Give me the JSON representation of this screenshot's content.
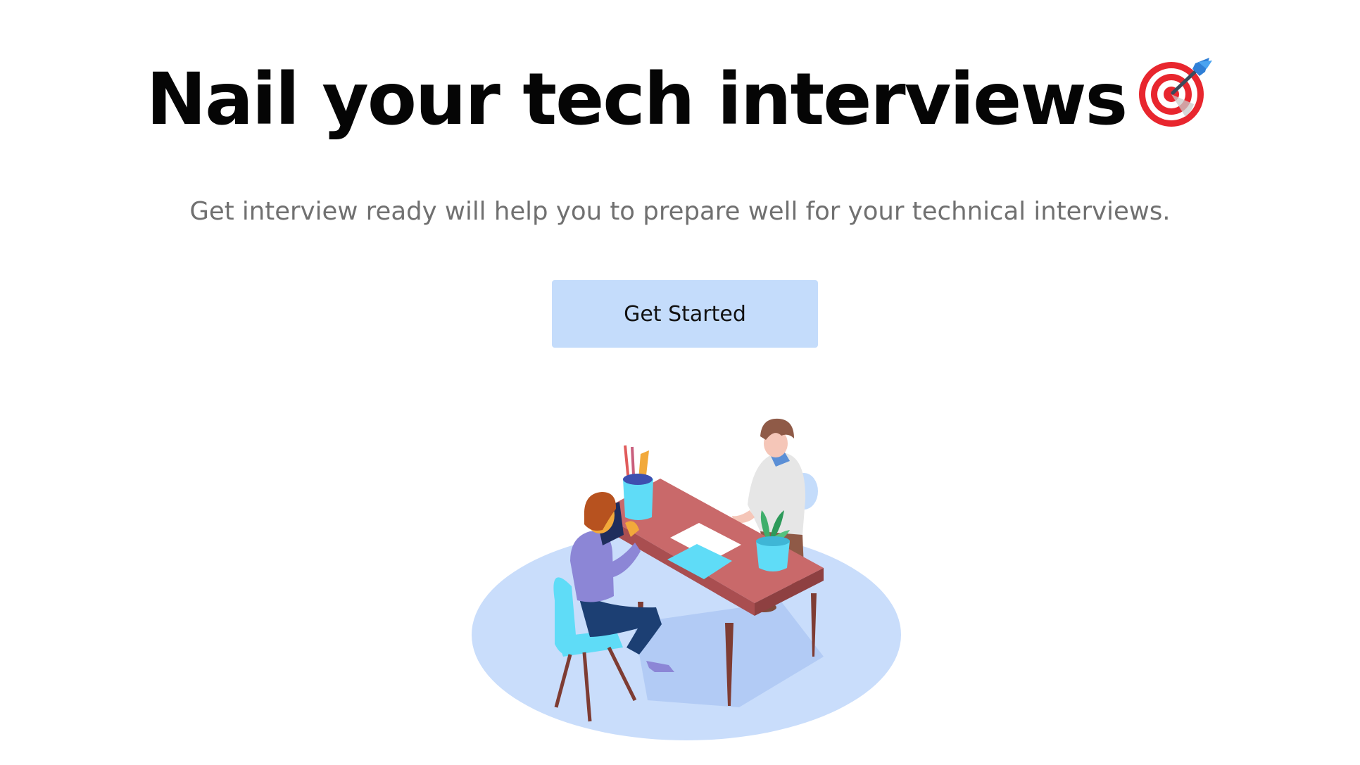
{
  "hero": {
    "title": "Nail your tech interviews",
    "title_icon": "direct-hit-target-icon",
    "subtitle": "Get interview ready will help you to prepare well for your technical interviews."
  },
  "cta": {
    "label": "Get Started"
  },
  "illustration": {
    "icon": "interview-table-illustration"
  },
  "colors": {
    "button_bg": "#c4dcfb",
    "title": "#050505",
    "subtitle": "#707070",
    "floor": "#c9ddfb",
    "table": "#c9696a",
    "accent_cyan": "#5fdcf7",
    "accent_purple": "#8c86d6"
  }
}
